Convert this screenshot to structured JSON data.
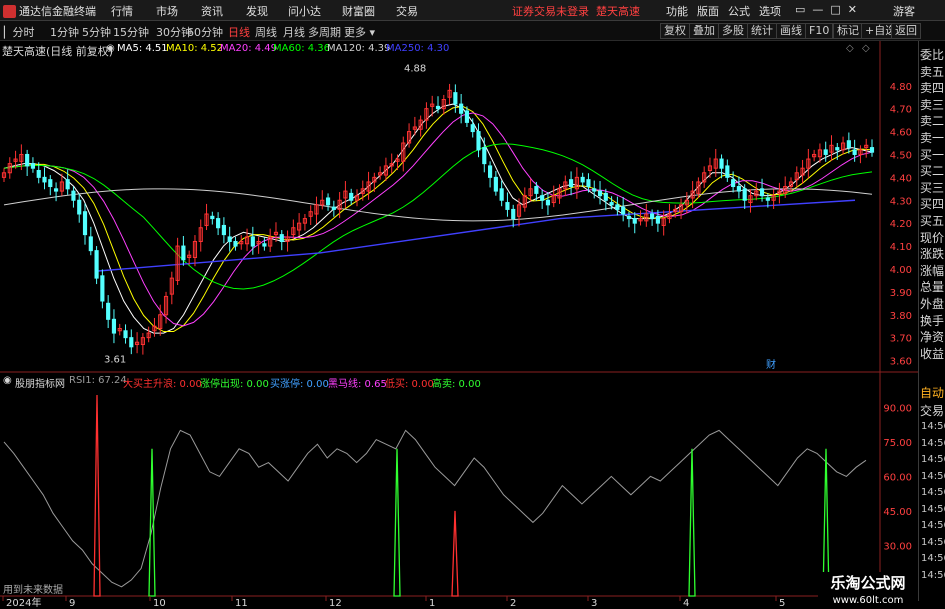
{
  "app": {
    "title": "通达信金融终端",
    "menus": [
      "行情",
      "市场",
      "资讯",
      "发现",
      "问小达",
      "财富圈",
      "交易"
    ],
    "notice": [
      "证券交易未登录",
      "楚天高速"
    ],
    "right_menus": [
      "功能",
      "版面",
      "公式",
      "选项"
    ],
    "guest": "游客"
  },
  "periods": {
    "tabs": [
      "分时",
      "1分钟",
      "5分钟",
      "15分钟",
      "30分钟",
      "60分钟",
      "日线",
      "周线",
      "月线",
      "多周期",
      "更多"
    ],
    "active": "日线"
  },
  "tools": [
    "复权",
    "叠加",
    "多股",
    "统计",
    "画线",
    "F10",
    "标记",
    "+自选",
    "返回"
  ],
  "main": {
    "legend": {
      "title": "楚天高速(日线 前复权)",
      "items": [
        {
          "label": "MA5: 4.51",
          "color": "#ffffff"
        },
        {
          "label": "MA10: 4.52",
          "color": "#ffff00"
        },
        {
          "label": "MA20: 4.49",
          "color": "#ff40ff"
        },
        {
          "label": "MA60: 4.36",
          "color": "#00ff00"
        },
        {
          "label": "MA120: 4.39",
          "color": "#d0d0d0"
        },
        {
          "label": "MA250: 4.30",
          "color": "#4040ff"
        }
      ]
    },
    "high_label": "4.88",
    "low_label": "3.61",
    "marker": "财"
  },
  "sub": {
    "title": "股朋指标网",
    "items": [
      {
        "label": "RSI1: 67.24",
        "color": "#9a9a9a"
      },
      {
        "label": "大买主升浪: 0.00",
        "color": "#ff3030"
      },
      {
        "label": "涨停出现: 0.00",
        "color": "#30ff30"
      },
      {
        "label": "买涨停: 0.00",
        "color": "#40a0ff"
      },
      {
        "label": "黑马线: 0.65",
        "color": "#ff40ff"
      },
      {
        "label": "低买: 0.00",
        "color": "#ff3030"
      },
      {
        "label": "高卖: 0.00",
        "color": "#30ff30"
      }
    ],
    "foot": "用到未来数据"
  },
  "right_panel": {
    "items": [
      "委比",
      "卖五",
      "卖四",
      "卖三",
      "卖二",
      "卖一",
      "买一",
      "买二",
      "买三",
      "买四",
      "买五",
      "现价",
      "涨跌",
      "涨幅",
      "总量",
      "外盘",
      "换手",
      "净资",
      "收益"
    ],
    "tabs": [
      "自动",
      "交易"
    ],
    "times": [
      "14:56",
      "14:56",
      "14:56",
      "14:56",
      "14:56",
      "14:56",
      "14:56",
      "14:56",
      "14:56",
      "14:56"
    ]
  },
  "x_axis": {
    "labels": [
      "2024年",
      "9",
      "10",
      "11",
      "12",
      "1",
      "2",
      "3",
      "4",
      "5"
    ]
  },
  "watermark": {
    "big": "乐淘公式网",
    "small": "www.60lt.com"
  },
  "colors": {
    "up": "#ff3232",
    "down": "#54ffff"
  },
  "chart_data": [
    {
      "type": "candlestick",
      "title": "",
      "x_unit": "trading day index",
      "ylim": [
        3.55,
        4.93
      ],
      "y_ticks": [
        4.8,
        4.7,
        4.6,
        4.5,
        4.4,
        4.3,
        4.2,
        4.1,
        4.0,
        3.9,
        3.8,
        3.7,
        3.6
      ],
      "close": [
        4.42,
        4.46,
        4.48,
        4.5,
        4.45,
        4.44,
        4.4,
        4.38,
        4.36,
        4.34,
        4.38,
        4.35,
        4.3,
        4.24,
        4.15,
        4.08,
        3.96,
        3.86,
        3.78,
        3.72,
        3.74,
        3.7,
        3.66,
        3.68,
        3.7,
        3.72,
        3.75,
        3.8,
        3.88,
        3.96,
        4.1,
        4.04,
        4.06,
        4.12,
        4.18,
        4.24,
        4.22,
        4.18,
        4.15,
        4.12,
        4.1,
        4.12,
        4.14,
        4.1,
        4.12,
        4.1,
        4.14,
        4.16,
        4.12,
        4.14,
        4.18,
        4.2,
        4.22,
        4.25,
        4.28,
        4.3,
        4.28,
        4.26,
        4.3,
        4.34,
        4.3,
        4.32,
        4.35,
        4.38,
        4.4,
        4.42,
        4.45,
        4.46,
        4.48,
        4.55,
        4.6,
        4.62,
        4.65,
        4.7,
        4.72,
        4.7,
        4.74,
        4.78,
        4.72,
        4.68,
        4.64,
        4.6,
        4.52,
        4.46,
        4.4,
        4.34,
        4.3,
        4.26,
        4.22,
        4.28,
        4.32,
        4.35,
        4.33,
        4.3,
        4.28,
        4.32,
        4.35,
        4.38,
        4.36,
        4.4,
        4.38,
        4.36,
        4.34,
        4.32,
        4.3,
        4.28,
        4.26,
        4.24,
        4.22,
        4.2,
        4.22,
        4.24,
        4.22,
        4.2,
        4.22,
        4.24,
        4.26,
        4.28,
        4.3,
        4.34,
        4.38,
        4.42,
        4.45,
        4.48,
        4.44,
        4.4,
        4.36,
        4.34,
        4.3,
        4.32,
        4.34,
        4.32,
        4.3,
        4.32,
        4.34,
        4.36,
        4.38,
        4.42,
        4.44,
        4.48,
        4.5,
        4.52,
        4.5,
        4.54,
        4.52,
        4.55,
        4.53,
        4.5,
        4.52,
        4.54,
        4.51
      ],
      "ma": {
        "MA5": [
          4.44,
          4.45,
          4.46,
          4.46,
          4.45,
          4.43,
          4.4,
          4.36,
          4.3,
          4.2,
          4.08,
          3.96,
          3.86,
          3.79,
          3.74,
          3.72,
          3.72,
          3.74,
          3.8,
          3.88,
          3.96,
          4.04,
          4.1,
          4.14,
          4.16,
          4.15,
          4.14,
          4.13,
          4.12,
          4.13,
          4.15,
          4.18,
          4.22,
          4.26,
          4.29,
          4.31,
          4.34,
          4.38,
          4.42,
          4.46,
          4.52,
          4.58,
          4.64,
          4.68,
          4.71,
          4.72,
          4.7,
          4.64,
          4.56,
          4.47,
          4.38,
          4.31,
          4.28,
          4.3,
          4.32,
          4.34,
          4.36,
          4.37,
          4.36,
          4.33,
          4.3,
          4.27,
          4.24,
          4.22,
          4.22,
          4.22,
          4.23,
          4.25,
          4.28,
          4.33,
          4.38,
          4.42,
          4.42,
          4.4,
          4.36,
          4.33,
          4.32,
          4.32,
          4.34,
          4.37,
          4.41,
          4.45,
          4.48,
          4.5,
          4.52,
          4.53,
          4.52,
          4.51
        ]
      }
    },
    {
      "type": "line",
      "title": "",
      "ylim": [
        8,
        98
      ],
      "y_ticks": [
        90,
        75,
        60,
        45,
        30,
        15
      ],
      "series": [
        {
          "name": "RSI1",
          "values": [
            75,
            70,
            64,
            58,
            52,
            44,
            38,
            32,
            28,
            22,
            18,
            14,
            12,
            15,
            20,
            35,
            55,
            72,
            80,
            78,
            70,
            62,
            60,
            66,
            72,
            70,
            64,
            66,
            62,
            58,
            64,
            70,
            74,
            68,
            72,
            70,
            66,
            70,
            76,
            74,
            72,
            80,
            76,
            70,
            64,
            60,
            56,
            62,
            68,
            64,
            58,
            52,
            48,
            44,
            40,
            44,
            50,
            56,
            52,
            48,
            52,
            56,
            60,
            56,
            52,
            56,
            60,
            58,
            62,
            66,
            70,
            74,
            78,
            80,
            76,
            72,
            68,
            64,
            60,
            56,
            62,
            68,
            72,
            70,
            66,
            62,
            60,
            64,
            67
          ]
        }
      ]
    }
  ]
}
